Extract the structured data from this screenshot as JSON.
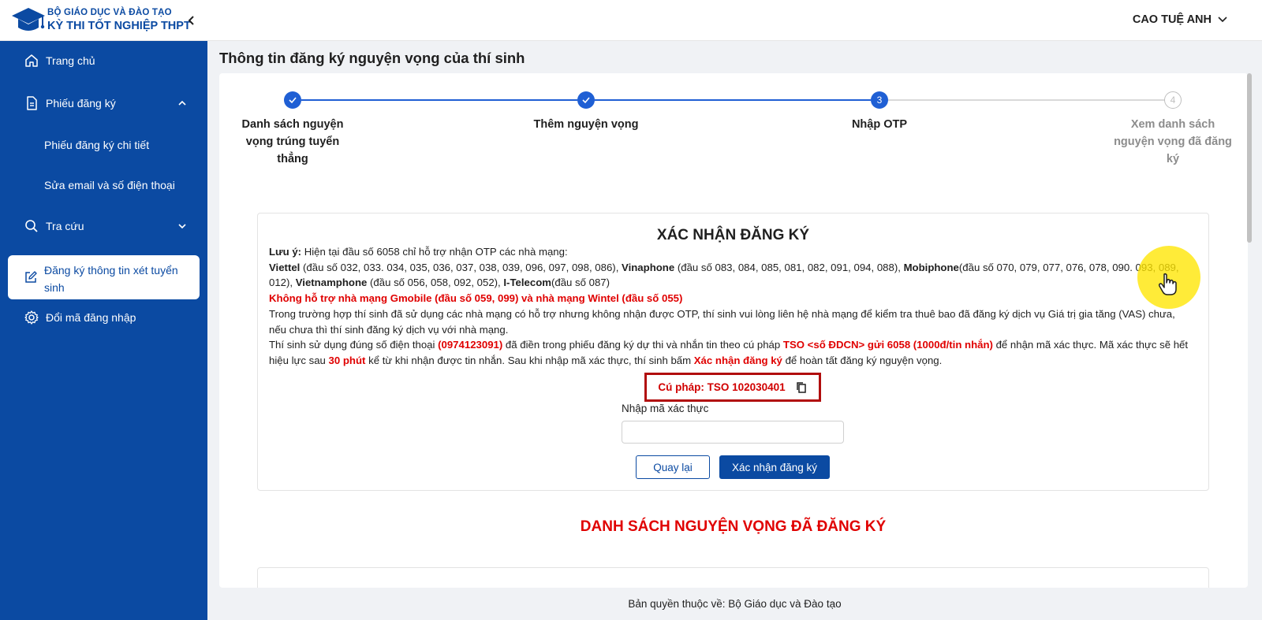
{
  "header": {
    "brand_line1": "BỘ GIÁO DỤC VÀ ĐÀO TẠO",
    "brand_line2": "KỲ THI TỐT NGHIỆP THPT",
    "user_name": "CAO TUỆ ANH"
  },
  "sidebar": {
    "items": [
      {
        "label": "Trang chủ",
        "icon": "home-icon"
      },
      {
        "label": "Phiếu đăng ký",
        "icon": "document-icon"
      },
      {
        "label": "Phiếu đăng ký chi tiết"
      },
      {
        "label": "Sửa email và số điện thoại"
      },
      {
        "label": "Tra cứu",
        "icon": "search-icon"
      },
      {
        "label": "Đăng ký thông tin xét tuyển sinh",
        "icon": "edit-icon",
        "active": true
      },
      {
        "label": "Đổi mã đăng nhập",
        "icon": "gear-icon"
      }
    ]
  },
  "page": {
    "title": "Thông tin đăng ký nguyện vọng của thí sinh"
  },
  "stepper": {
    "steps": [
      {
        "label": "Danh sách nguyện vọng trúng tuyển thẳng",
        "status": "done"
      },
      {
        "label": "Thêm nguyện vọng",
        "status": "done"
      },
      {
        "label": "Nhập OTP",
        "status": "current",
        "number": "3"
      },
      {
        "label": "Xem danh sách nguyện vọng đã đăng ký",
        "status": "todo",
        "number": "4"
      }
    ]
  },
  "confirm": {
    "title": "XÁC NHẬN ĐĂNG KÝ",
    "note_label": "Lưu ý:",
    "note_text": " Hiện tại đầu số 6058 chỉ hỗ trợ nhận OTP các nhà mạng:",
    "carriers": {
      "viettel": "Viettel",
      "viettel_prefixes": " (đầu số 032, 033. 034, 035, 036, 037, 038, 039, 096, 097, 098, 086), ",
      "vinaphone": "Vinaphone",
      "vinaphone_prefixes": " (đầu số 083, 084, 085, 081, 082, 091, 094, 088), ",
      "mobiphone": "Mobiphone",
      "mobiphone_prefixes": "(đầu số 070, 079, 077, 076, 078, 090. 093, 089, 012), ",
      "vietnamphone": "Vietnamphone",
      "vietnamphone_prefixes": " (đầu số 056, 058, 092, 052), ",
      "itelecom": "I-Telecom",
      "itelecom_prefixes": "(đầu số 087)"
    },
    "unsupported": "Không hỗ trợ nhà mạng Gmobile (đầu số 059, 099) và nhà mạng Wintel (đầu số 055)",
    "vas_note": "Trong trường hợp thí sinh đã sử dụng các nhà mạng có hỗ trợ nhưng không nhận được OTP, thí sinh vui lòng liên hệ nhà mạng để kiểm tra thuê bao đã đăng ký dịch vụ Giá trị gia tăng (VAS) chưa, nếu chưa thì thí sinh đăng ký dịch vụ với nhà mạng.",
    "instr_1": "Thí sinh sử dụng đúng số điện thoại ",
    "phone": "(0974123091)",
    "instr_2": " đã điền trong phiếu đăng ký dự thi và nhắn tin theo cú pháp ",
    "sms_syntax": "TSO <số ĐDCN> gửi 6058 (1000đ/tin nhắn)",
    "instr_3": " để nhận mã xác thực. Mã xác thực sẽ hết hiệu lực sau ",
    "expiry": "30 phút",
    "instr_4": " kể từ khi nhận được tin nhắn. Sau khi nhập mã xác thực, thí sinh bấm ",
    "confirm_phrase": "Xác nhận đăng ký",
    "instr_5": " để hoàn tất đăng ký nguyện vọng.",
    "syntax_box": "Cú pháp: TSO 102030401",
    "otp_label": "Nhập mã xác thực",
    "otp_value": "",
    "back_button": "Quay lại",
    "confirm_button": "Xác nhận đăng ký"
  },
  "list": {
    "title": "DANH SÁCH NGUYỆN VỌNG ĐÃ ĐĂNG KÝ"
  },
  "footer": {
    "text": "Bản quyền thuộc về: Bộ Giáo dục và Đào tạo"
  },
  "colors": {
    "primary": "#0b4aa2",
    "accent_red": "#e00000",
    "step_blue": "#1f5fd4"
  }
}
